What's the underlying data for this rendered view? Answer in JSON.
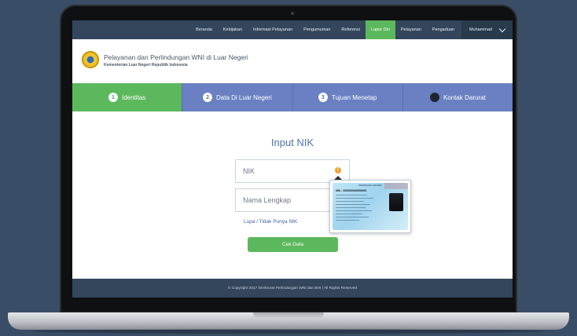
{
  "nav": {
    "items": [
      "Beranda",
      "Kebijakan",
      "Informasi Pelayanan",
      "Pengumuman",
      "Referensi",
      "Lapor Diri",
      "Pelayanan",
      "Pengaduan"
    ],
    "active_index": 5,
    "user": "Muhammad"
  },
  "header": {
    "title": "Pelayanan dan Perlindungan WNI di Luar Negeri",
    "subtitle": "Kementerian Luar Negeri Republik Indonesia"
  },
  "steps": [
    {
      "num": "1",
      "label": "Identitas",
      "active": true
    },
    {
      "num": "2",
      "label": "Data Di Luar Negeri",
      "active": false
    },
    {
      "num": "3",
      "label": "Tujuan Menetap",
      "active": false
    },
    {
      "num": "",
      "label": "Kontak Darurat",
      "active": false
    }
  ],
  "form": {
    "title": "Input NIK",
    "nik_placeholder": "NIK",
    "name_placeholder": "Nama Lengkap",
    "forgot_link": "Lupa / Tidak Punya NIK",
    "submit_label": "Cek Data",
    "info_icon": "!"
  },
  "ktp": {
    "header": "PROVINSI DKI JAKARTA",
    "nik_label": "NIK : 000000000000000"
  },
  "footer": {
    "text": "© Copyright 2017 Direktorat Perlindungan WNI dan BHI | All Rights Reserved"
  },
  "colors": {
    "background": "#3a4d66",
    "nav": "#34465c",
    "accent_green": "#5cb85c",
    "step_blue": "#6a80c2",
    "title_blue": "#4f72b0"
  },
  "icons": [
    "chevron-down-icon",
    "logo-emblem",
    "info-icon"
  ]
}
